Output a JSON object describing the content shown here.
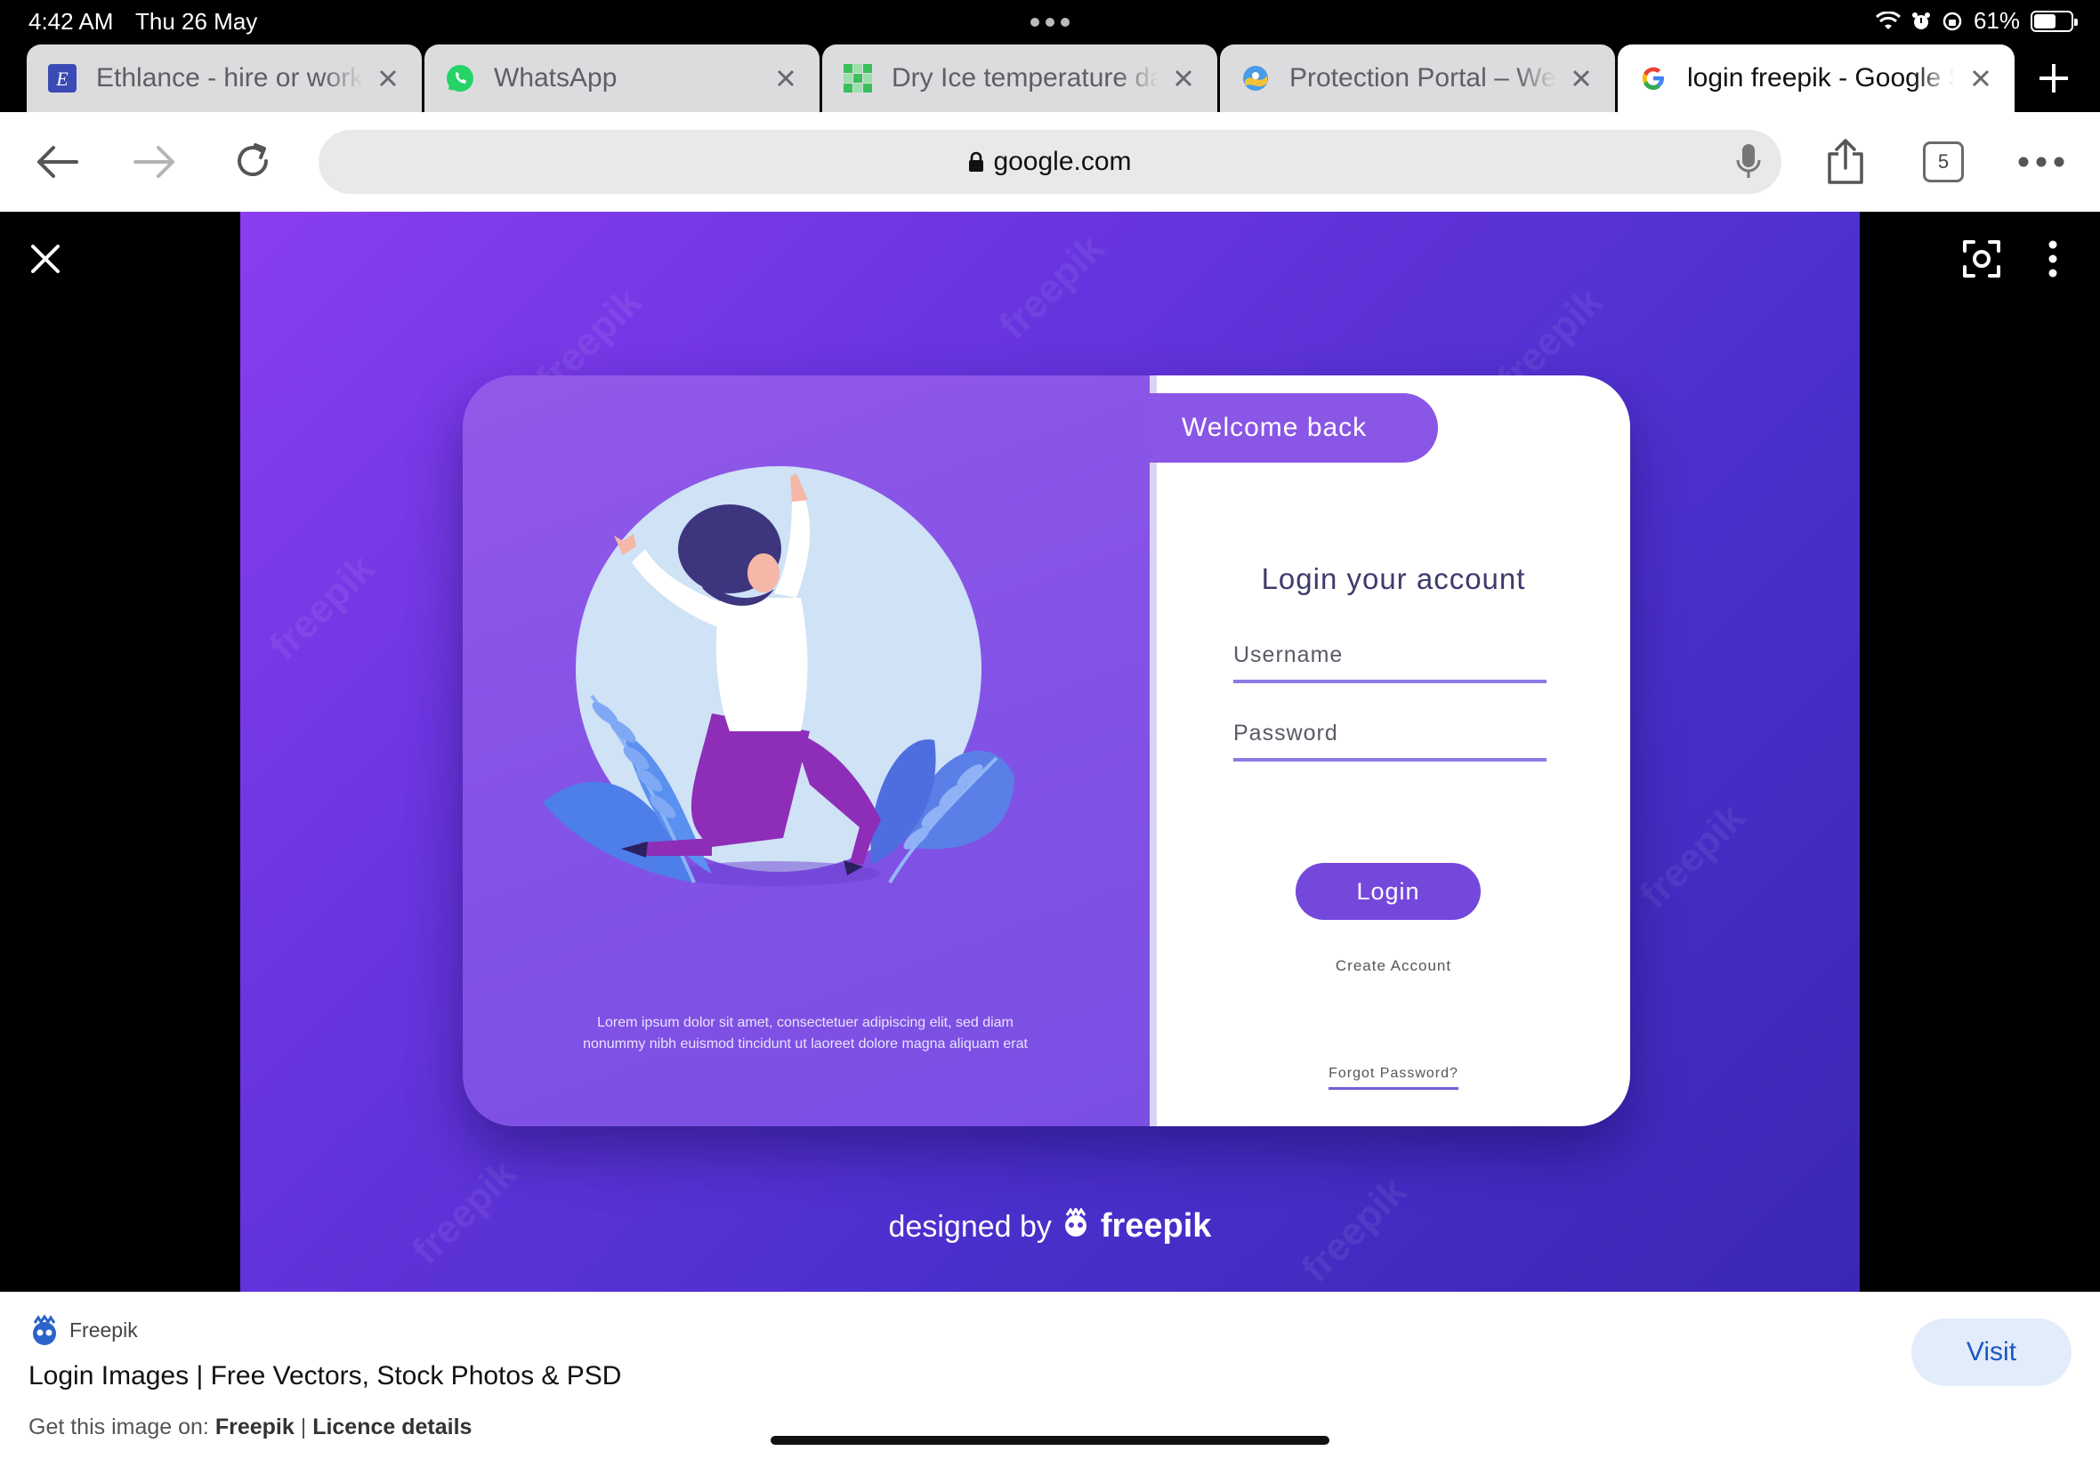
{
  "status": {
    "time": "4:42 AM",
    "date": "Thu 26 May",
    "battery": "61%",
    "battery_level": 0.61
  },
  "tabs": [
    {
      "label": "Ethlance - hire or work f",
      "favicon": "ethlance-icon"
    },
    {
      "label": "WhatsApp",
      "favicon": "whatsapp-icon"
    },
    {
      "label": "Dry Ice temperature data",
      "favicon": "dry-ice-icon"
    },
    {
      "label": "Protection Portal – We I",
      "favicon": "protection-portal-icon"
    },
    {
      "label": "login freepik - Google Se",
      "favicon": "google-icon",
      "active": true
    }
  ],
  "toolbar": {
    "url": "google.com",
    "tab_count": "5"
  },
  "image": {
    "card": {
      "welcome": "Welcome back",
      "heading": "Login your account",
      "username_placeholder": "Username",
      "password_placeholder": "Password",
      "login_label": "Login",
      "create_account": "Create Account",
      "forgot_password": "Forgot Password?",
      "lorem_line1": "Lorem ipsum dolor sit amet, consectetuer adipiscing elit, sed diam",
      "lorem_line2": "nonummy nibh euismod tincidunt ut laoreet dolore magna aliquam erat"
    },
    "credit_prefix": "designed by",
    "credit_brand": "freepik",
    "watermark": "freepik"
  },
  "result": {
    "source": "Freepik",
    "title": "Login Images | Free Vectors, Stock Photos & PSD",
    "get_prefix": "Get this image on:",
    "get_source": "Freepik",
    "separator": "|",
    "licence": "Licence details",
    "visit_label": "Visit"
  },
  "colors": {
    "accent": "#7548dc",
    "card_left": "#8352e6",
    "background_top": "#8a3ef0",
    "background_bottom": "#3a27b5",
    "visit_text": "#1a57c2"
  }
}
